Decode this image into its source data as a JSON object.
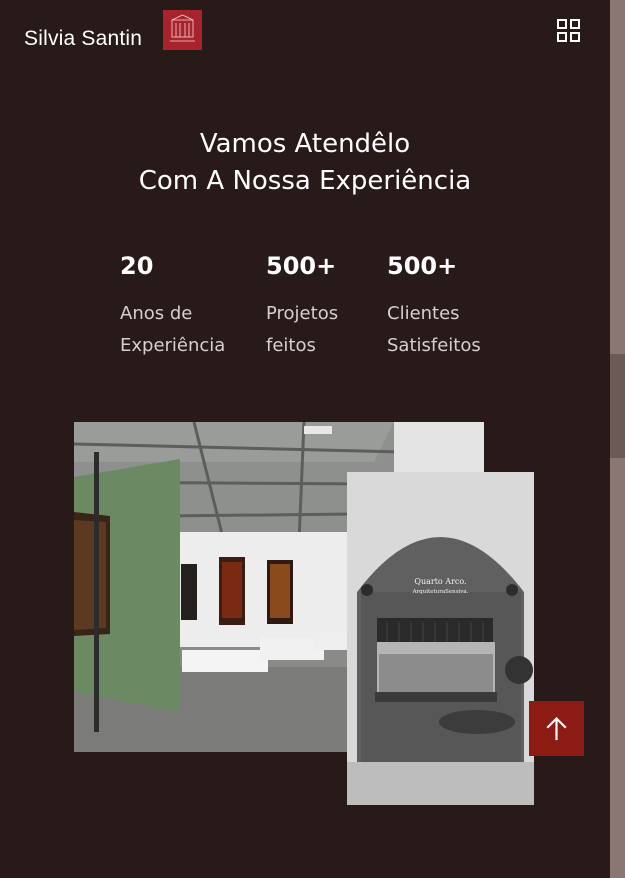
{
  "header": {
    "brand": "Silvia Santin",
    "logo_icon": "building-logo-icon",
    "menu_icon": "grid-menu-icon"
  },
  "hero": {
    "line1": "Vamos Atendêlo",
    "line2": "Com A Nossa Experiência"
  },
  "stats": [
    {
      "number": "20",
      "label_line1": "Anos de",
      "label_line2": "Experiência"
    },
    {
      "number": "500+",
      "label_line1": "Projetos",
      "label_line2": "feitos"
    },
    {
      "number": "500+",
      "label_line1": "Clientes",
      "label_line2": "Satisfeitos"
    }
  ],
  "images": {
    "gallery": "art-gallery-render",
    "bedroom": "bedroom-render",
    "bedroom_caption_title": "Quarto Arco.",
    "bedroom_caption_sub": "ArquiteturaSensiva."
  },
  "back_to_top_icon": "arrow-up-icon",
  "colors": {
    "background": "#281a19",
    "accent": "#8c1b13",
    "logo": "#a8232b",
    "text": "#ffffff"
  }
}
